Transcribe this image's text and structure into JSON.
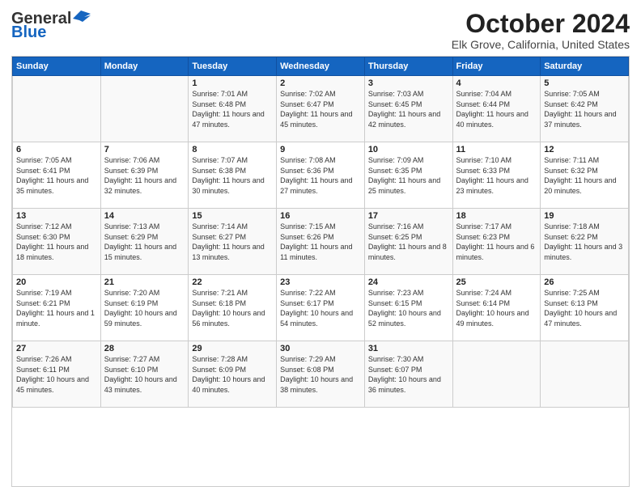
{
  "header": {
    "logo_general": "General",
    "logo_blue": "Blue",
    "title": "October 2024",
    "subtitle": "Elk Grove, California, United States"
  },
  "weekdays": [
    "Sunday",
    "Monday",
    "Tuesday",
    "Wednesday",
    "Thursday",
    "Friday",
    "Saturday"
  ],
  "weeks": [
    [
      {
        "day": "",
        "info": ""
      },
      {
        "day": "",
        "info": ""
      },
      {
        "day": "1",
        "info": "Sunrise: 7:01 AM\nSunset: 6:48 PM\nDaylight: 11 hours and 47 minutes."
      },
      {
        "day": "2",
        "info": "Sunrise: 7:02 AM\nSunset: 6:47 PM\nDaylight: 11 hours and 45 minutes."
      },
      {
        "day": "3",
        "info": "Sunrise: 7:03 AM\nSunset: 6:45 PM\nDaylight: 11 hours and 42 minutes."
      },
      {
        "day": "4",
        "info": "Sunrise: 7:04 AM\nSunset: 6:44 PM\nDaylight: 11 hours and 40 minutes."
      },
      {
        "day": "5",
        "info": "Sunrise: 7:05 AM\nSunset: 6:42 PM\nDaylight: 11 hours and 37 minutes."
      }
    ],
    [
      {
        "day": "6",
        "info": "Sunrise: 7:05 AM\nSunset: 6:41 PM\nDaylight: 11 hours and 35 minutes."
      },
      {
        "day": "7",
        "info": "Sunrise: 7:06 AM\nSunset: 6:39 PM\nDaylight: 11 hours and 32 minutes."
      },
      {
        "day": "8",
        "info": "Sunrise: 7:07 AM\nSunset: 6:38 PM\nDaylight: 11 hours and 30 minutes."
      },
      {
        "day": "9",
        "info": "Sunrise: 7:08 AM\nSunset: 6:36 PM\nDaylight: 11 hours and 27 minutes."
      },
      {
        "day": "10",
        "info": "Sunrise: 7:09 AM\nSunset: 6:35 PM\nDaylight: 11 hours and 25 minutes."
      },
      {
        "day": "11",
        "info": "Sunrise: 7:10 AM\nSunset: 6:33 PM\nDaylight: 11 hours and 23 minutes."
      },
      {
        "day": "12",
        "info": "Sunrise: 7:11 AM\nSunset: 6:32 PM\nDaylight: 11 hours and 20 minutes."
      }
    ],
    [
      {
        "day": "13",
        "info": "Sunrise: 7:12 AM\nSunset: 6:30 PM\nDaylight: 11 hours and 18 minutes."
      },
      {
        "day": "14",
        "info": "Sunrise: 7:13 AM\nSunset: 6:29 PM\nDaylight: 11 hours and 15 minutes."
      },
      {
        "day": "15",
        "info": "Sunrise: 7:14 AM\nSunset: 6:27 PM\nDaylight: 11 hours and 13 minutes."
      },
      {
        "day": "16",
        "info": "Sunrise: 7:15 AM\nSunset: 6:26 PM\nDaylight: 11 hours and 11 minutes."
      },
      {
        "day": "17",
        "info": "Sunrise: 7:16 AM\nSunset: 6:25 PM\nDaylight: 11 hours and 8 minutes."
      },
      {
        "day": "18",
        "info": "Sunrise: 7:17 AM\nSunset: 6:23 PM\nDaylight: 11 hours and 6 minutes."
      },
      {
        "day": "19",
        "info": "Sunrise: 7:18 AM\nSunset: 6:22 PM\nDaylight: 11 hours and 3 minutes."
      }
    ],
    [
      {
        "day": "20",
        "info": "Sunrise: 7:19 AM\nSunset: 6:21 PM\nDaylight: 11 hours and 1 minute."
      },
      {
        "day": "21",
        "info": "Sunrise: 7:20 AM\nSunset: 6:19 PM\nDaylight: 10 hours and 59 minutes."
      },
      {
        "day": "22",
        "info": "Sunrise: 7:21 AM\nSunset: 6:18 PM\nDaylight: 10 hours and 56 minutes."
      },
      {
        "day": "23",
        "info": "Sunrise: 7:22 AM\nSunset: 6:17 PM\nDaylight: 10 hours and 54 minutes."
      },
      {
        "day": "24",
        "info": "Sunrise: 7:23 AM\nSunset: 6:15 PM\nDaylight: 10 hours and 52 minutes."
      },
      {
        "day": "25",
        "info": "Sunrise: 7:24 AM\nSunset: 6:14 PM\nDaylight: 10 hours and 49 minutes."
      },
      {
        "day": "26",
        "info": "Sunrise: 7:25 AM\nSunset: 6:13 PM\nDaylight: 10 hours and 47 minutes."
      }
    ],
    [
      {
        "day": "27",
        "info": "Sunrise: 7:26 AM\nSunset: 6:11 PM\nDaylight: 10 hours and 45 minutes."
      },
      {
        "day": "28",
        "info": "Sunrise: 7:27 AM\nSunset: 6:10 PM\nDaylight: 10 hours and 43 minutes."
      },
      {
        "day": "29",
        "info": "Sunrise: 7:28 AM\nSunset: 6:09 PM\nDaylight: 10 hours and 40 minutes."
      },
      {
        "day": "30",
        "info": "Sunrise: 7:29 AM\nSunset: 6:08 PM\nDaylight: 10 hours and 38 minutes."
      },
      {
        "day": "31",
        "info": "Sunrise: 7:30 AM\nSunset: 6:07 PM\nDaylight: 10 hours and 36 minutes."
      },
      {
        "day": "",
        "info": ""
      },
      {
        "day": "",
        "info": ""
      }
    ]
  ]
}
